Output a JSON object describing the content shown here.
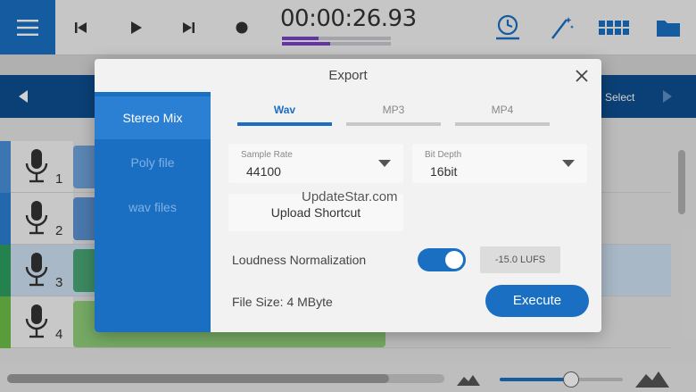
{
  "topbar": {
    "time": "00:00:26.93",
    "meter_levels": [
      0.34,
      0.44
    ]
  },
  "bluebar": {
    "select_label": "Select"
  },
  "tracks": [
    {
      "number": "1",
      "color": "#4a90d9"
    },
    {
      "number": "2",
      "color": "#2b7fd4"
    },
    {
      "number": "3",
      "color": "#2e9e5e"
    },
    {
      "number": "4",
      "color": "#6cbf4a"
    }
  ],
  "zoom": {
    "level": 0.58
  },
  "modal": {
    "title": "Export",
    "sidebar": [
      "Stereo Mix",
      "Poly file",
      "wav files"
    ],
    "active_sidebar": 0,
    "tabs": [
      "Wav",
      "MP3",
      "MP4"
    ],
    "active_tab": 0,
    "sample_rate": {
      "label": "Sample Rate",
      "value": "44100"
    },
    "bit_depth": {
      "label": "Bit Depth",
      "value": "16bit"
    },
    "upload_label": "Upload Shortcut",
    "watermark": "UpdateStar.com",
    "loudness_label": "Loudness Normalization",
    "loudness_on": true,
    "lufs_value": "-15.0 LUFS",
    "file_size": "File Size: 4 MByte",
    "execute_label": "Execute"
  },
  "colors": {
    "accent": "#1a6fc2",
    "bar_dark": "#0e4f91",
    "meter": "#7b3fc9"
  }
}
